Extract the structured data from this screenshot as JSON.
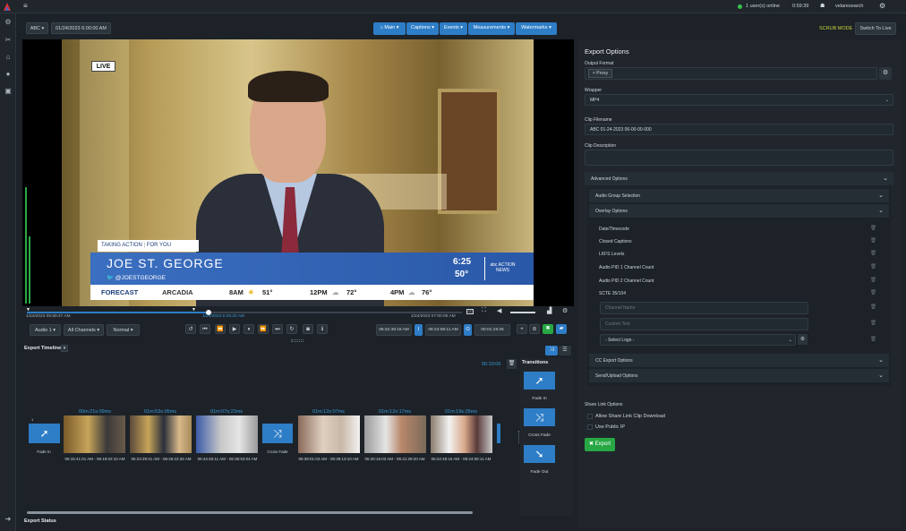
{
  "topbar": {
    "users_online": "1 user(s) online",
    "clock": "0:59:39",
    "username": "velaresearch"
  },
  "toolbar": {
    "channel": "ABC",
    "datetime": "01/24/2023 6:00:00 AM",
    "menus": [
      "Main",
      "Captions",
      "Events",
      "Measurements",
      "Watermarks"
    ],
    "scrub_mode": "SCRUB MODE",
    "switch_live": "Switch To Live"
  },
  "video": {
    "live_badge": "LIVE",
    "lower_third_tag1": "TAKING ACTION",
    "lower_third_tag2": "FOR YOU",
    "name": "JOE ST. GEORGE",
    "handle": "@JOESTGEORGE",
    "time": "6:25",
    "temp": "50°",
    "station_logo": "abc ACTION NEWS",
    "forecast_label": "FORECAST",
    "forecast_city": "ARCADIA",
    "forecast_items": [
      "8AM",
      "51°",
      "12PM",
      "72°",
      "4PM",
      "76°"
    ]
  },
  "scrubber": {
    "start": "1/24/2023 05:59:47 AM",
    "current": "1/24/2023 6:25:20 AM",
    "end": "1/24/2023 07:00:06 AM"
  },
  "controls": {
    "audio": "Audio 1",
    "channels": "All Channels",
    "speed": "Normal",
    "in_time": "06:22:48:15 AM",
    "out_time": "06:24:08:11 AM",
    "duration": "00:01:19:26",
    "in_marker": "I",
    "out_marker": "O",
    "dur_marker": "D"
  },
  "timeline": {
    "title": "Export Timeline",
    "total": "00:10:06",
    "transitions_title": "Transitions",
    "transitions": [
      "Fade In",
      "Cross Fade",
      "Fade Out"
    ],
    "clips": [
      {
        "len": "",
        "time": "",
        "label": "Fade In"
      },
      {
        "len": "00m:21s:09ms",
        "time": "06:15:41:01 AM - 06:19:02:10 AM"
      },
      {
        "len": "01m:53s:05ms",
        "time": "06:24:29:21 AM - 06:26:22:26 AM"
      },
      {
        "len": "01m:07s:23ms",
        "time": "06:34:45:11 AM - 06:35:53:04 AM"
      },
      {
        "len": "",
        "time": "",
        "label": "Cross Fade"
      },
      {
        "len": "01m:12s:07ms",
        "time": "06:38:01:03 AM - 06:39:13:10 AM"
      },
      {
        "len": "01m:12s:17ms",
        "time": "06:40:16:03 AM - 06:41:28:20 AM"
      },
      {
        "len": "01m:19s:26ms",
        "time": "06:22:48:15 AM - 06:24:08:11 AM"
      }
    ],
    "seq_badge": "1",
    "export_status": "Export Status"
  },
  "export": {
    "title": "Export Options",
    "output_format_label": "Output Format",
    "output_format_value": "× Proxy",
    "wrapper_label": "Wrapper",
    "wrapper_value": "MP4",
    "clip_filename_label": "Clip Filename",
    "clip_filename_value": "ABC 01-24-2023 06-00-00-000",
    "clip_description_label": "Clip Description",
    "advanced_options": "Advanced Options",
    "audio_group_selection": "Audio Group Selection",
    "overlay_options": "Overlay Options",
    "overlay_items": [
      "Date/Timecode",
      "Closed Captions",
      "LKFS Levels",
      "Audio PID 1 Channel Count",
      "Audio PID 2 Channel Count",
      "SCTE 35/104"
    ],
    "channel_name_placeholder": "Channel Name",
    "custom_text_placeholder": "Custom Text",
    "select_logo": "- Select Logo -",
    "cc_export_options": "CC Export Options",
    "send_upload_options": "Send/Upload Options",
    "share_link_options": "Share Link Options",
    "allow_share_link": "Allow Share Link Clip Download",
    "use_public_ip": "Use Public IP",
    "export_button": "✖ Export"
  },
  "colors": {
    "accent_blue": "#2e7dc7",
    "export_green": "#27a844",
    "scrub_yellow": "#c9d43a",
    "online_green": "#37c14a"
  }
}
